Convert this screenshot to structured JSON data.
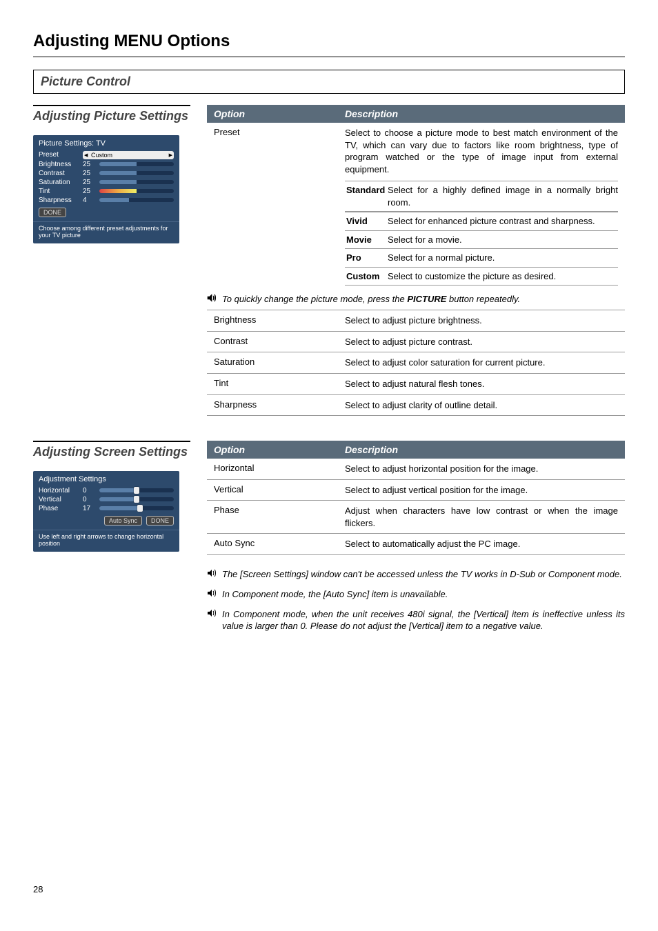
{
  "page": {
    "main_title": "Adjusting MENU Options",
    "section_title": "Picture Control",
    "page_number": "28"
  },
  "headers": {
    "option": "Option",
    "description": "Description"
  },
  "adj_picture": {
    "heading": "Adjusting Picture Settings",
    "osd_title": "Picture Settings: TV",
    "preset_label": "Preset",
    "preset_value": "Custom",
    "brightness_label": "Brightness",
    "brightness_val": "25",
    "contrast_label": "Contrast",
    "contrast_val": "25",
    "saturation_label": "Saturation",
    "saturation_val": "25",
    "tint_label": "Tint",
    "tint_val": "25",
    "sharpness_label": "Sharpness",
    "sharpness_val": "4",
    "done_label": "DONE",
    "help_text": "Choose among different preset adjustments for your TV picture"
  },
  "pic_table": {
    "preset": {
      "name": "Preset",
      "desc": "Select to choose a picture mode to best match environment of the TV, which can vary due to factors like room brightness, type of program watched or the type of image input from external equipment.",
      "standard_k": "Standard",
      "standard_v": "Select for a highly defined image in a normally bright room.",
      "vivid_k": "Vivid",
      "vivid_v": "Select for enhanced picture contrast and sharpness.",
      "movie_k": "Movie",
      "movie_v": "Select for a movie.",
      "pro_k": "Pro",
      "pro_v": "Select for a normal picture.",
      "custom_k": "Custom",
      "custom_v": "Select to customize the picture as desired."
    },
    "note_before": "To quickly change the picture mode, press the ",
    "note_bold": "PICTURE",
    "note_after": " button repeatedly.",
    "brightness_k": "Brightness",
    "brightness_v": "Select to adjust picture brightness.",
    "contrast_k": "Contrast",
    "contrast_v": "Select to adjust picture contrast.",
    "saturation_k": "Saturation",
    "saturation_v": "Select to adjust color saturation for current picture.",
    "tint_k": "Tint",
    "tint_v": "Select to adjust natural flesh tones.",
    "sharpness_k": "Sharpness",
    "sharpness_v": "Select to adjust clarity of outline detail."
  },
  "adj_screen": {
    "heading": "Adjusting Screen Settings",
    "osd_title": "Adjustment Settings",
    "h_label": "Horizontal",
    "h_val": "0",
    "v_label": "Vertical",
    "v_val": "0",
    "p_label": "Phase",
    "p_val": "17",
    "autosync_label": "Auto Sync",
    "done_label": "DONE",
    "help_text": "Use left and right arrows to change horizontal position"
  },
  "scr_table": {
    "h_k": "Horizontal",
    "h_v": "Select to adjust horizontal position for the image.",
    "v_k": "Vertical",
    "v_v": "Select to adjust vertical position for the image.",
    "p_k": "Phase",
    "p_v": "Adjust when characters have low contrast or when the image flickers.",
    "a_k": "Auto Sync",
    "a_v": "Select to automatically adjust the PC image."
  },
  "notes": {
    "n1": "The [Screen Settings] window can't be accessed unless the TV works in D-Sub or Component mode.",
    "n2": "In Component mode, the [Auto Sync] item is unavailable.",
    "n3": "In Component mode, when the unit receives 480i signal, the [Vertical] item is ineffective unless its value is larger than 0. Please do not adjust the [Vertical] item to a negative value."
  }
}
